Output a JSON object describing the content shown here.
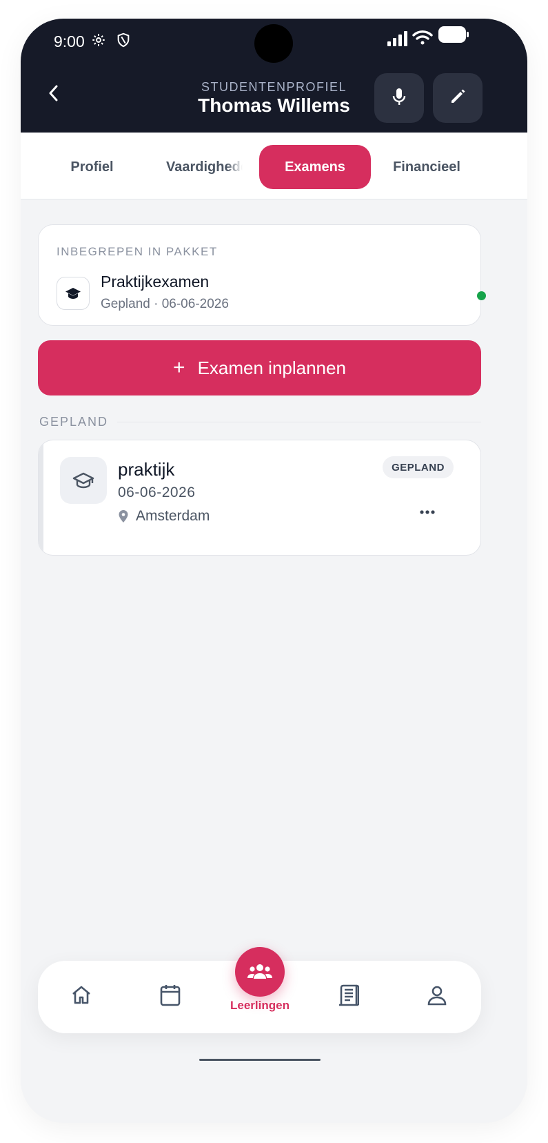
{
  "status_bar": {
    "time": "9:00"
  },
  "header": {
    "subtitle": "STUDENTENPROFIEL",
    "title": "Thomas Willems"
  },
  "tabs": [
    {
      "label": "Profiel"
    },
    {
      "label": "Vaardigheden"
    },
    {
      "label": "Examens",
      "active": true
    },
    {
      "label": "Financieel"
    }
  ],
  "package_card": {
    "label": "INBEGREPEN IN PAKKET",
    "title": "Praktijkexamen",
    "subtitle": "Gepland · 06-06-2026",
    "status_color": "#16a34a"
  },
  "cta": {
    "icon": "+",
    "label": "Examen inplannen"
  },
  "section": {
    "label": "GEPLAND"
  },
  "exam": {
    "title": "praktijk",
    "date": "06-06-2026",
    "location": "Amsterdam",
    "badge": "GEPLAND"
  },
  "nav": {
    "items": [
      "home-icon",
      "calendar-icon",
      "students-icon",
      "receipt-icon",
      "profile-icon"
    ],
    "active_label": "Leerlingen"
  },
  "colors": {
    "accent": "#d62e5e",
    "header_bg": "#161a28"
  }
}
